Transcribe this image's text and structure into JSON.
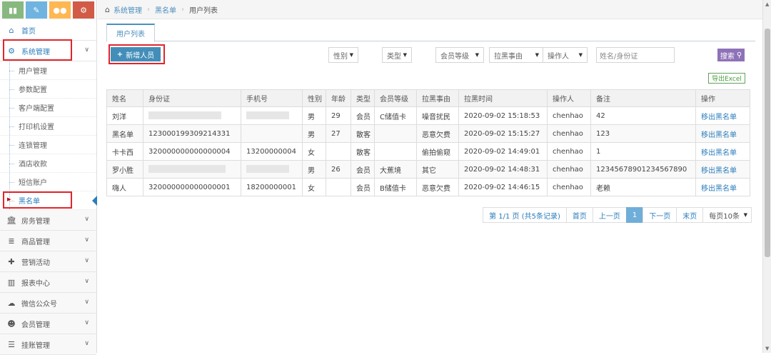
{
  "breadcrumb": {
    "items": [
      "系统管理",
      "黑名单",
      "用户列表"
    ]
  },
  "sidebar": {
    "top_buttons": [
      {
        "icon": "bar-chart-icon",
        "color": "#87b87f"
      },
      {
        "icon": "pencil-icon",
        "color": "#6fb3e0"
      },
      {
        "icon": "users-icon",
        "color": "#ffb752"
      },
      {
        "icon": "cogs-icon",
        "color": "#d15b47"
      }
    ],
    "home": "首页",
    "system": "系统管理",
    "sub_items": [
      "用户管理",
      "参数配置",
      "客户端配置",
      "打印机设置",
      "连锁管理",
      "酒店收款",
      "短信账户",
      "黑名单"
    ],
    "groups": [
      "房务管理",
      "商品管理",
      "营销活动",
      "报表中心",
      "微信公众号",
      "会员管理",
      "挂账管理"
    ]
  },
  "tab_label": "用户列表",
  "toolbar": {
    "add_label": "新增人员",
    "filters": [
      "性别",
      "类型",
      "会员等级",
      "拉黑事由",
      "操作人"
    ],
    "search_placeholder": "姓名/身份证",
    "search_label": "搜索",
    "excel_label": "导出Excel"
  },
  "table": {
    "headers": [
      "姓名",
      "身份证",
      "手机号",
      "性别",
      "年龄",
      "类型",
      "会员等级",
      "拉黑事由",
      "拉黑时间",
      "操作人",
      "备注",
      "操作"
    ],
    "rows": [
      {
        "name": "刘洋",
        "id": "",
        "phone": "",
        "gender": "男",
        "age": "29",
        "type": "会员",
        "level": "C储值卡",
        "reason": "噪音扰民",
        "time": "2020-09-02 15:18:53",
        "operator": "chenhao",
        "note": "42",
        "action": "移出黑名单"
      },
      {
        "name": "黑名单",
        "id": "123000199309214331",
        "phone": "",
        "gender": "男",
        "age": "27",
        "type": "散客",
        "level": "",
        "reason": "恶意欠费",
        "time": "2020-09-02 15:15:27",
        "operator": "chenhao",
        "note": "123",
        "action": "移出黑名单"
      },
      {
        "name": "卡卡西",
        "id": "320000000000000004",
        "phone": "13200000004",
        "gender": "女",
        "age": "",
        "type": "散客",
        "level": "",
        "reason": "偷拍偷窥",
        "time": "2020-09-02 14:49:01",
        "operator": "chenhao",
        "note": "1",
        "action": "移出黑名单"
      },
      {
        "name": "罗小胜",
        "id": "",
        "phone": "",
        "gender": "男",
        "age": "26",
        "type": "会员",
        "level": "大蕉境",
        "reason": "其它",
        "time": "2020-09-02 14:48:31",
        "operator": "chenhao",
        "note": "12345678901234567890",
        "action": "移出黑名单"
      },
      {
        "name": "嗨人",
        "id": "320000000000000001",
        "phone": "18200000001",
        "gender": "女",
        "age": "",
        "type": "会员",
        "level": "B储值卡",
        "reason": "恶意欠费",
        "time": "2020-09-02 14:46:15",
        "operator": "chenhao",
        "note": "老赖",
        "action": "移出黑名单"
      }
    ]
  },
  "pagination": {
    "summary": "第 1/1 页 (共5条记录)",
    "first": "首页",
    "prev": "上一页",
    "current": "1",
    "next": "下一页",
    "last": "末页",
    "per_page": "每页10条"
  }
}
